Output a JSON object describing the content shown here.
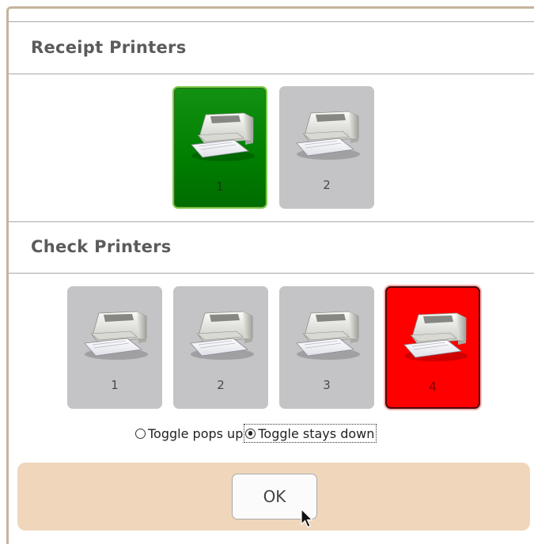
{
  "receipt_section": {
    "title": "Receipt Printers",
    "printers": [
      {
        "label": "1",
        "state": "selected-green"
      },
      {
        "label": "2",
        "state": "normal"
      }
    ]
  },
  "check_section": {
    "title": "Check Printers",
    "printers": [
      {
        "label": "1",
        "state": "normal"
      },
      {
        "label": "2",
        "state": "normal"
      },
      {
        "label": "3",
        "state": "normal"
      },
      {
        "label": "4",
        "state": "selected-red"
      }
    ]
  },
  "toggle": {
    "pops_up_label": "Toggle pops up",
    "stays_down_label": "Toggle stays down",
    "selected": "stays_down"
  },
  "footer": {
    "ok_label": "OK"
  },
  "colors": {
    "selected_green": "#008000",
    "selected_red": "#ff0000",
    "tile_normal": "#c4c3c6",
    "footer_bg": "#f0d7bb"
  },
  "icons": {
    "printer": "printer-icon",
    "cursor": "arrow-cursor-icon"
  }
}
